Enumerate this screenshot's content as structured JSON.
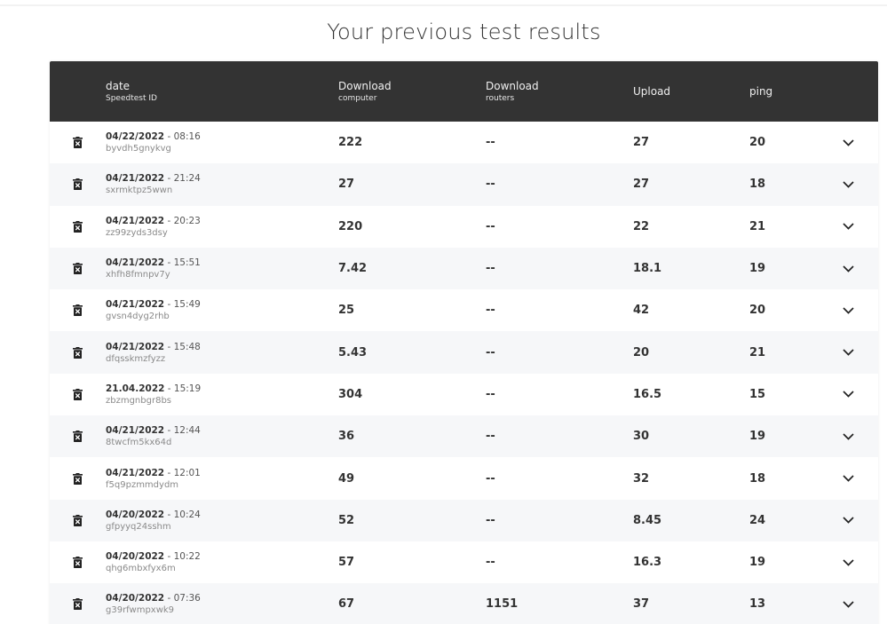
{
  "page": {
    "title": "Your previous test results"
  },
  "table": {
    "headers": {
      "date": {
        "main": "date",
        "sub": "Speedtest ID"
      },
      "download_computer": {
        "main": "Download",
        "sub": "computer"
      },
      "download_routers": {
        "main": "Download",
        "sub": "routers"
      },
      "upload": {
        "main": "Upload"
      },
      "ping": {
        "main": "ping"
      }
    },
    "icons": {
      "delete": "trash-icon",
      "expand": "chevron-down-icon"
    },
    "rows": [
      {
        "date": "04/22/2022",
        "time": "08:16",
        "id": "byvdh5gnykvg",
        "download_computer": "222",
        "download_routers": "--",
        "upload": "27",
        "ping": "20"
      },
      {
        "date": "04/21/2022",
        "time": "21:24",
        "id": "sxrmktpz5wwn",
        "download_computer": "27",
        "download_routers": "--",
        "upload": "27",
        "ping": "18"
      },
      {
        "date": "04/21/2022",
        "time": "20:23",
        "id": "zz99zyds3dsy",
        "download_computer": "220",
        "download_routers": "--",
        "upload": "22",
        "ping": "21"
      },
      {
        "date": "04/21/2022",
        "time": "15:51",
        "id": "xhfh8fmnpv7y",
        "download_computer": "7.42",
        "download_routers": "--",
        "upload": "18.1",
        "ping": "19"
      },
      {
        "date": "04/21/2022",
        "time": "15:49",
        "id": "gvsn4dyg2rhb",
        "download_computer": "25",
        "download_routers": "--",
        "upload": "42",
        "ping": "20"
      },
      {
        "date": "04/21/2022",
        "time": "15:48",
        "id": "dfqsskmzfyzz",
        "download_computer": "5.43",
        "download_routers": "--",
        "upload": "20",
        "ping": "21"
      },
      {
        "date": "21.04.2022",
        "time": "15:19",
        "id": "zbzmgnbgr8bs",
        "download_computer": "304",
        "download_routers": "--",
        "upload": "16.5",
        "ping": "15"
      },
      {
        "date": "04/21/2022",
        "time": "12:44",
        "id": "8twcfm5kx64d",
        "download_computer": "36",
        "download_routers": "--",
        "upload": "30",
        "ping": "19"
      },
      {
        "date": "04/21/2022",
        "time": "12:01",
        "id": "f5q9pzmmdydm",
        "download_computer": "49",
        "download_routers": "--",
        "upload": "32",
        "ping": "18"
      },
      {
        "date": "04/20/2022",
        "time": "10:24",
        "id": "gfpyyq24sshm",
        "download_computer": "52",
        "download_routers": "--",
        "upload": "8.45",
        "ping": "24"
      },
      {
        "date": "04/20/2022",
        "time": "10:22",
        "id": "qhg6mbxfyx6m",
        "download_computer": "57",
        "download_routers": "--",
        "upload": "16.3",
        "ping": "19"
      },
      {
        "date": "04/20/2022",
        "time": "07:36",
        "id": "g39rfwmpxwk9",
        "download_computer": "67",
        "download_routers": "1151",
        "upload": "37",
        "ping": "13"
      }
    ]
  },
  "colors": {
    "header_bg": "#333333",
    "row_alt_bg": "#f6f7f9",
    "text": "#333333",
    "id_text": "#8a8a8a"
  }
}
